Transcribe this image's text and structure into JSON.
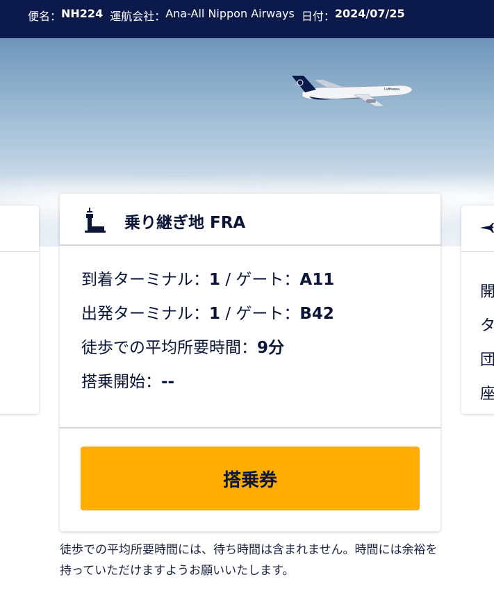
{
  "flight_bar": {
    "flight_label": "便名：",
    "flight_no": "NH224",
    "carrier_label": "運航会社：",
    "carrier": "Ana-All Nippon Airways",
    "date_label": "日付：",
    "date": "2024/07/25"
  },
  "transfer_card": {
    "icon": "control-tower-icon",
    "title": "乗り継ぎ地 FRA",
    "arrival_label": "到着ターミナル：",
    "arrival_terminal": "1",
    "arrival_gate_label": " / ゲート：",
    "arrival_gate": "A11",
    "departure_label": "出発ターミナル：",
    "departure_terminal": "1",
    "departure_gate_label": " / ゲート：",
    "departure_gate": "B42",
    "walk_label": "徒歩での平均所要時間：",
    "walk_time": "9分",
    "boarding_label": "搭乗開始：",
    "boarding_time": "--",
    "button_label": "搭乗券"
  },
  "right_card": {
    "icon": "airplane-icon",
    "chars": [
      "開",
      "タ",
      "団",
      "座"
    ]
  },
  "note": {
    "text": "徒歩での平均所要時間には、待ち時間は含まれません。時間には余裕を持っていただけますようお願いいたします。"
  },
  "colors": {
    "navy": "#0b1a4a",
    "accent": "#ffad00",
    "text": "#0b1538"
  }
}
